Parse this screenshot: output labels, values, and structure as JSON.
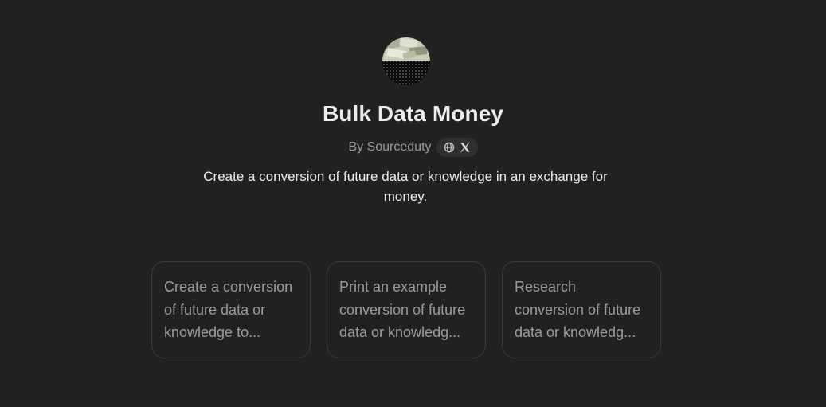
{
  "gpt": {
    "avatar_icon": "money-data-avatar",
    "title": "Bulk Data Money",
    "byline": "By Sourceduty",
    "social_icons": [
      "globe-icon",
      "x-logo-icon"
    ],
    "description": "Create a conversion of future data or knowledge in an exchange for money."
  },
  "conversation_starters": [
    {
      "text": "Create a conversion of future data or knowledge to..."
    },
    {
      "text": "Print an example conversion of future data or knowledg..."
    },
    {
      "text": "Research conversion of future data or knowledg..."
    }
  ],
  "colors": {
    "background": "#212121",
    "title": "#ececec",
    "muted": "#9b9b9b",
    "card_border": "#3b3b3b",
    "pill": "#2f2f2f"
  }
}
